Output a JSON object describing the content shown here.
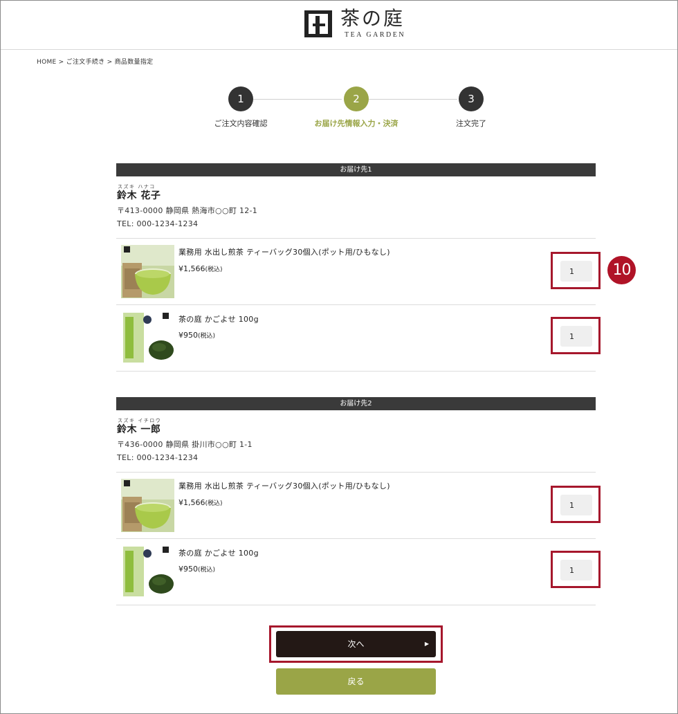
{
  "header": {
    "logo_jp": "茶の庭",
    "logo_en": "TEA GARDEN"
  },
  "breadcrumb": "HOME > ご注文手続き > 商品数量指定",
  "steps": [
    {
      "num": "1",
      "label": "ご注文内容確認"
    },
    {
      "num": "2",
      "label": "お届け先情報入力・決済"
    },
    {
      "num": "3",
      "label": "注文完了"
    }
  ],
  "destinations": [
    {
      "heading": "お届け先1",
      "ruby": "スズキ ハナコ",
      "name": "鈴木 花子",
      "address": "〒413-0000 静岡県 熱海市○○町 12-1",
      "tel": "TEL: 000-1234-1234",
      "items": [
        {
          "name": "業務用 水出し煎茶 ティーバッグ30個入(ポット用/ひもなし)",
          "price": "¥1,566",
          "tax": "(税込)",
          "qty": "1"
        },
        {
          "name": "茶の庭 かごよせ 100g",
          "price": "¥950",
          "tax": "(税込)",
          "qty": "1"
        }
      ]
    },
    {
      "heading": "お届け先2",
      "ruby": "スズキ イチロウ",
      "name": "鈴木 一郎",
      "address": "〒436-0000 静岡県 掛川市○○町 1-1",
      "tel": "TEL: 000-1234-1234",
      "items": [
        {
          "name": "業務用 水出し煎茶 ティーバッグ30個入(ポット用/ひもなし)",
          "price": "¥1,566",
          "tax": "(税込)",
          "qty": "1"
        },
        {
          "name": "茶の庭 かごよせ 100g",
          "price": "¥950",
          "tax": "(税込)",
          "qty": "1"
        }
      ]
    }
  ],
  "annotation": "10",
  "buttons": {
    "next": "次へ",
    "back": "戻る"
  },
  "colors": {
    "accent": "#9aa547",
    "dark": "#231815",
    "highlight": "#a6172c"
  }
}
